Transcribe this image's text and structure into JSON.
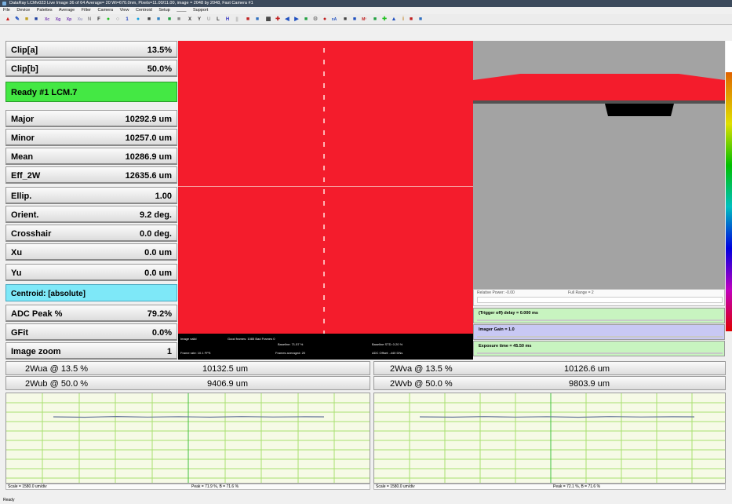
{
  "window": {
    "title": "DataRay LCMv023 Live Image 36 of 64  Average= 20    Wi=670.0nm, Pixels=11.00/11.00, image = 2048 by 2048, Fast  Camera #1"
  },
  "menu": [
    "File",
    "Device",
    "Palettes",
    "Average",
    "Filter",
    "Camera",
    "View",
    "Centroid",
    "Setup",
    "____",
    "Support"
  ],
  "rows": [
    {
      "label": "Clip[a]",
      "value": "13.5%"
    },
    {
      "label": "Clip[b]",
      "value": "50.0%"
    },
    {
      "label": "Ready    #1 LCM.7",
      "value": ""
    },
    {
      "label": "Major",
      "value": "10292.9 um"
    },
    {
      "label": "Minor",
      "value": "10257.0 um"
    },
    {
      "label": "Mean",
      "value": "10286.9 um"
    },
    {
      "label": "Eff_2W",
      "value": "12635.6 um"
    },
    {
      "label": "Ellip.",
      "value": "1.00"
    },
    {
      "label": "Orient.",
      "value": "9.2 deg."
    },
    {
      "label": "Crosshair",
      "value": "0.0 deg."
    },
    {
      "label": "Xu",
      "value": "0.0 um"
    },
    {
      "label": "Yu",
      "value": "0.0 um"
    },
    {
      "label": "Centroid: [absolute]",
      "value": ""
    },
    {
      "label": "ADC Peak %",
      "value": "79.2%"
    },
    {
      "label": "GFit",
      "value": "0.0%"
    },
    {
      "label": "Image zoom",
      "value": "1"
    }
  ],
  "image_stats": {
    "valid": "Image valid",
    "good": "Good frames: 1085 Bad Frames 0",
    "baseline": "Baseline: 71.57 %",
    "baseline_std": "Baseline STD: 0.20 %",
    "frame_rate": "Frame rate: 10.1 FPS",
    "averaged": "Frames averaged: 20",
    "adc": "ADC Offset: -440 DNs"
  },
  "profile": {
    "relative_power": "Relative Power: -0.00",
    "full_range": "Full Range = 2"
  },
  "controls": {
    "trigger": "(Trigger off) delay = 0.000 ms",
    "gain": "Imager Gain = 1.0",
    "exposure": "Exposure time = 45.50 ms"
  },
  "widths": [
    {
      "label": "2Wua @ 13.5 %",
      "value": "10132.5 um"
    },
    {
      "label": "2Wva @ 13.5 %",
      "value": "10126.6 um"
    },
    {
      "label": "2Wub @ 50.0 %",
      "value": "9406.9 um"
    },
    {
      "label": "2Wvb @ 50.0 %",
      "value": "9803.9 um"
    }
  ],
  "charts": {
    "left": {
      "scale": "Scale = 1580.0 um/div",
      "peak": "Peak = 71.9 %,  B = 71.6 %"
    },
    "right": {
      "scale": "Scale = 1580.0 um/div",
      "peak": "Peak = 72.1 %,  B = 71.6 %"
    }
  },
  "status": "Ready",
  "colors": {
    "beam": "#f41c2c",
    "ready": "#44e844",
    "centroid": "#7ee8f8",
    "profile_bg": "#a3a3a3",
    "chart_bg": "#f6fae6"
  }
}
